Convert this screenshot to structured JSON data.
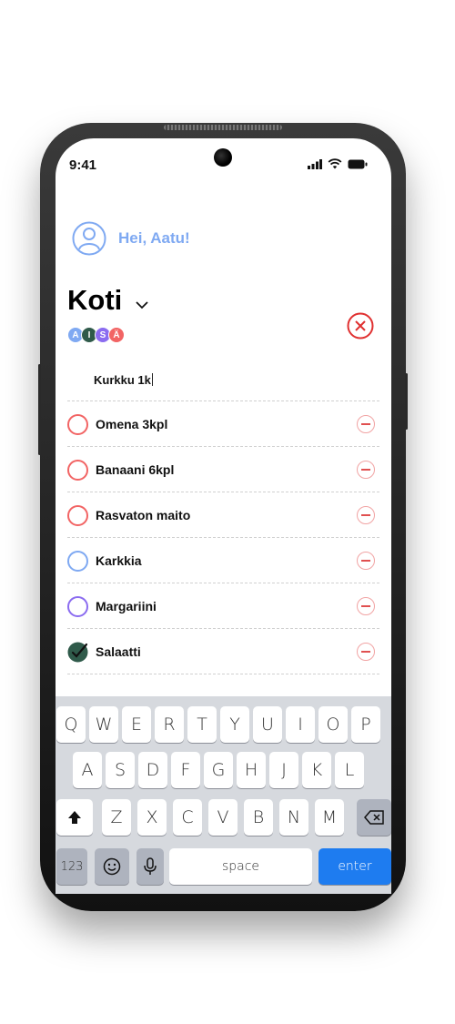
{
  "status_bar": {
    "time": "9:41"
  },
  "header": {
    "greeting": "Hei, Aatu!"
  },
  "list": {
    "title": "Koti",
    "members": [
      {
        "initial": "A",
        "color": "#7fa9f2"
      },
      {
        "initial": "I",
        "color": "#2f5a4a"
      },
      {
        "initial": "S",
        "color": "#8b6cf0"
      },
      {
        "initial": "Ä",
        "color": "#f26464"
      }
    ],
    "new_item_value": "Kurkku 1k",
    "items": [
      {
        "label": "Omena 3kpl",
        "color": "#f26464",
        "checked": false
      },
      {
        "label": "Banaani 6kpl",
        "color": "#f26464",
        "checked": false
      },
      {
        "label": "Rasvaton maito",
        "color": "#f26464",
        "checked": false
      },
      {
        "label": "Karkkia",
        "color": "#7fa9f2",
        "checked": false
      },
      {
        "label": "Margariini",
        "color": "#8b6cf0",
        "checked": false
      },
      {
        "label": "Salaatti",
        "color": "#2f5a4a",
        "checked": true
      }
    ]
  },
  "keyboard": {
    "row1": [
      "Q",
      "W",
      "E",
      "R",
      "T",
      "Y",
      "U",
      "I",
      "O",
      "P"
    ],
    "row2": [
      "A",
      "S",
      "D",
      "F",
      "G",
      "H",
      "J",
      "K",
      "L"
    ],
    "row3": [
      "Z",
      "X",
      "C",
      "V",
      "B",
      "N",
      "M"
    ],
    "numbers_label": "123",
    "space_label": "space",
    "enter_label": "enter"
  },
  "colors": {
    "accent": "#7fa9f2",
    "danger": "#e03030",
    "enter": "#1e7cf0"
  }
}
